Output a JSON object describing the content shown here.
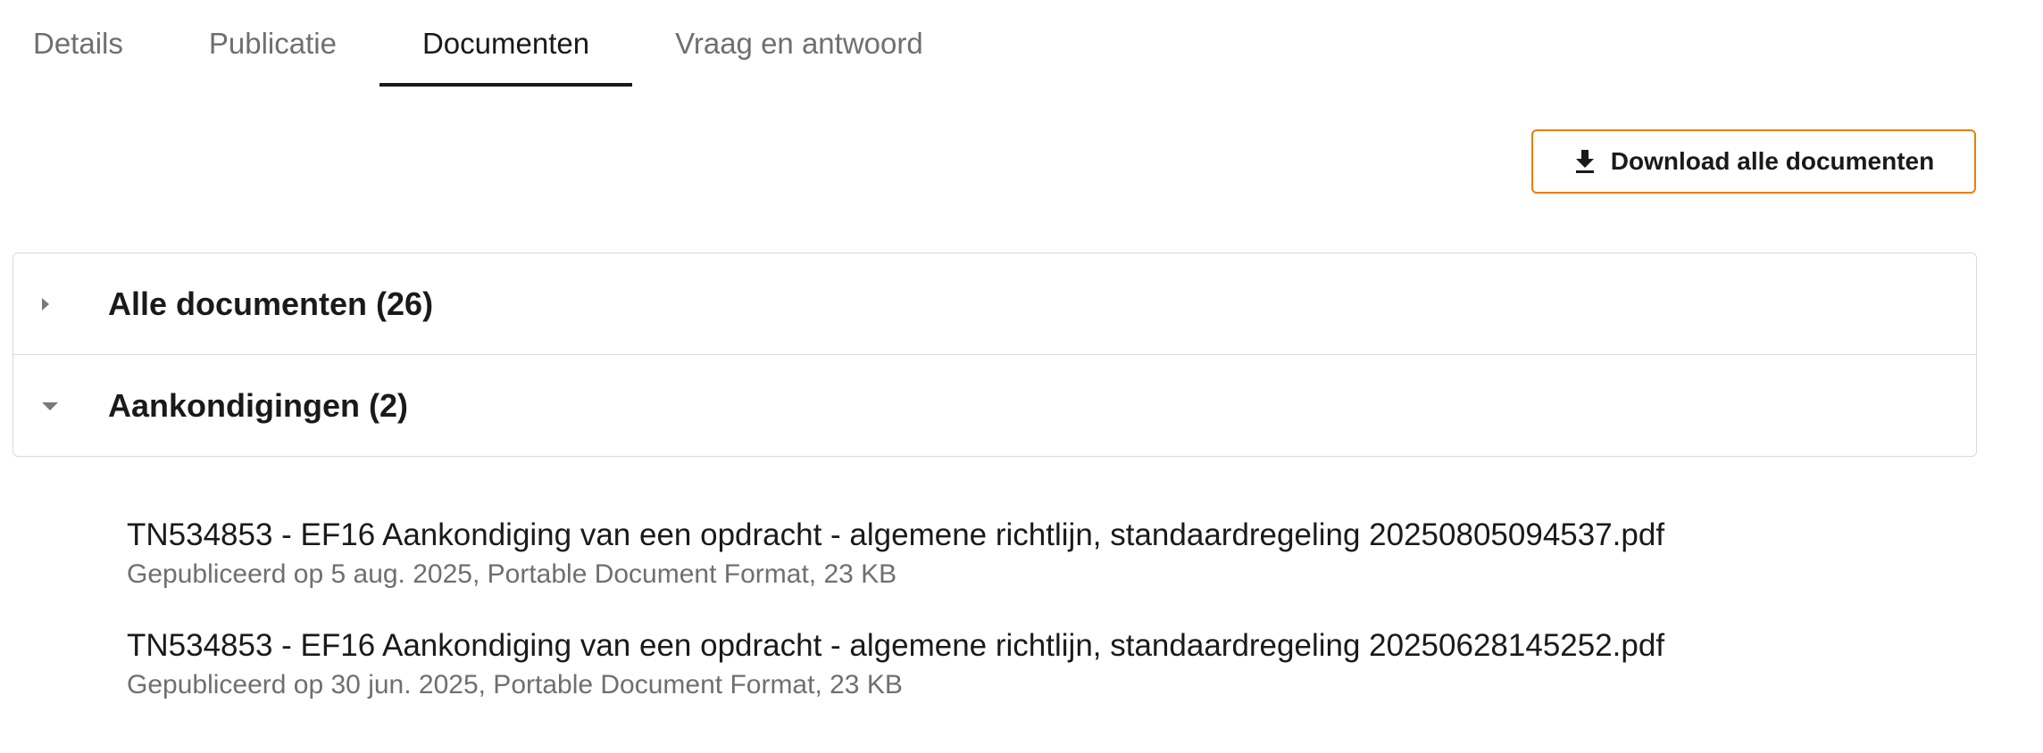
{
  "tabs": [
    {
      "label": "Details",
      "active": false
    },
    {
      "label": "Publicatie",
      "active": false
    },
    {
      "label": "Documenten",
      "active": true
    },
    {
      "label": "Vraag en antwoord",
      "active": false
    }
  ],
  "download_button": {
    "label": "Download alle documenten",
    "icon": "download-icon",
    "border_color": "#f07d00"
  },
  "accordion": [
    {
      "title": "Alle documenten (26)",
      "expanded": false,
      "icon": "caret-right-icon"
    },
    {
      "title": "Aankondigingen (2)",
      "expanded": true,
      "icon": "caret-down-icon"
    }
  ],
  "documents": [
    {
      "title": "TN534853 - EF16 Aankondiging van een opdracht - algemene richtlijn, standaardregeling 20250805094537.pdf",
      "meta": "Gepubliceerd op 5 aug. 2025, Portable Document Format, 23 KB"
    },
    {
      "title": "TN534853 - EF16 Aankondiging van een opdracht - algemene richtlijn, standaardregeling 20250628145252.pdf",
      "meta": "Gepubliceerd op 30 jun. 2025, Portable Document Format, 23 KB"
    }
  ]
}
